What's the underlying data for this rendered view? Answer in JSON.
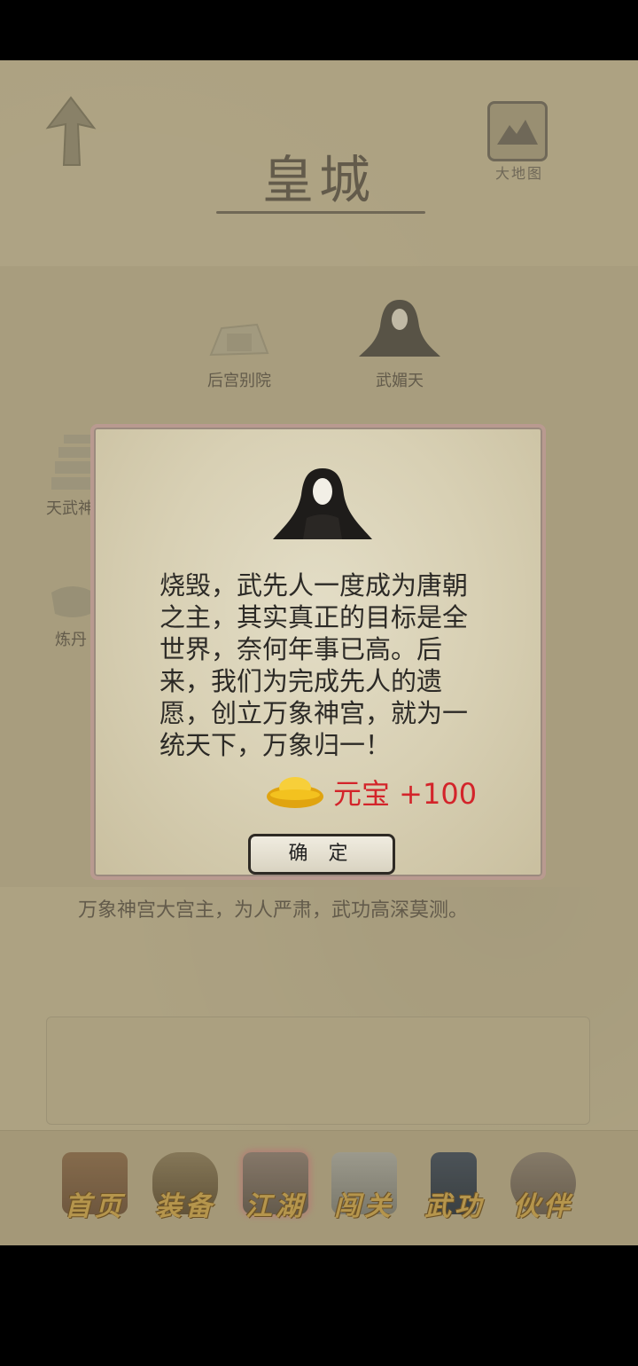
{
  "header": {
    "title": "皇城",
    "map_label": "大地图"
  },
  "locations": [
    {
      "label": "后宫别院"
    },
    {
      "label": "武媚天"
    },
    {
      "label": "天武神"
    },
    {
      "label": "炼丹"
    }
  ],
  "description": "万象神宫大宫主，为人严肃，武功高深莫测。",
  "dialog": {
    "text": "烧毁，武先人一度成为唐朝之主，其实真正的目标是全世界，奈何年事已高。后来，我们为完成先人的遗愿，创立万象神宫，就为一统天下，万象归一！",
    "reward": "元宝 +100",
    "confirm_label": "确 定"
  },
  "tabs": [
    {
      "label": "首页",
      "icon": "house-icon"
    },
    {
      "label": "装备",
      "icon": "armor-icon"
    },
    {
      "label": "江湖",
      "icon": "scroll-icon"
    },
    {
      "label": "闯关",
      "icon": "swords-icon"
    },
    {
      "label": "武功",
      "icon": "book-icon"
    },
    {
      "label": "伙伴",
      "icon": "people-icon"
    }
  ],
  "colors": {
    "background": "#bfb392",
    "reward_text": "#d3242a",
    "tab_label": "#caa24a"
  }
}
